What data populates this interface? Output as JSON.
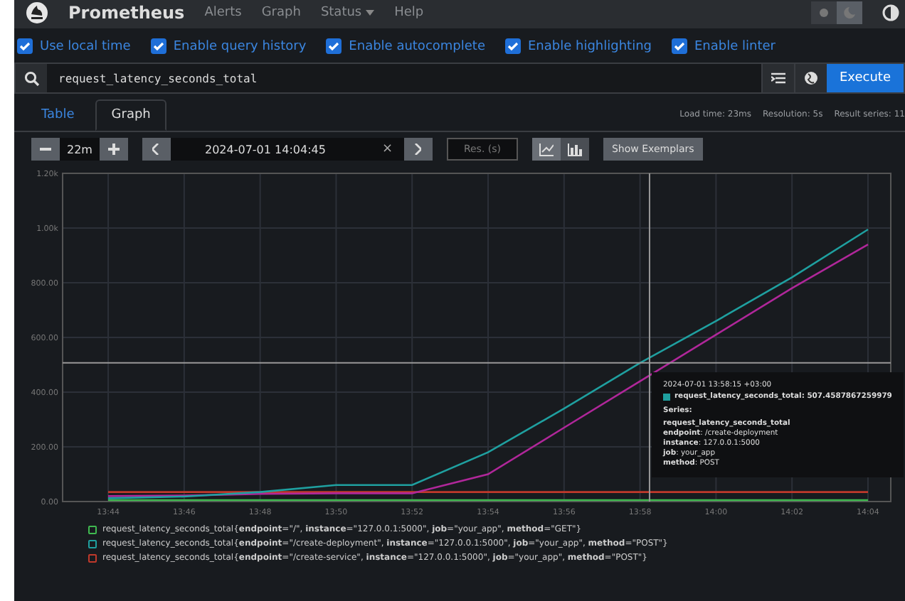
{
  "navbar": {
    "brand": "Prometheus",
    "links": [
      {
        "label": "Alerts",
        "dropdown": false
      },
      {
        "label": "Graph",
        "dropdown": false
      },
      {
        "label": "Status",
        "dropdown": true
      },
      {
        "label": "Help",
        "dropdown": false
      }
    ],
    "dark_mode": true
  },
  "options": [
    {
      "label": "Use local time",
      "checked": true
    },
    {
      "label": "Enable query history",
      "checked": true
    },
    {
      "label": "Enable autocomplete",
      "checked": true
    },
    {
      "label": "Enable highlighting",
      "checked": true
    },
    {
      "label": "Enable linter",
      "checked": true
    }
  ],
  "query": {
    "value": "request_latency_seconds_total",
    "execute": "Execute"
  },
  "tabs": [
    {
      "label": "Table",
      "selected": false
    },
    {
      "label": "Graph",
      "selected": true
    }
  ],
  "stats": [
    "Load time: 23ms",
    "Resolution: 5s",
    "Result series: 11"
  ],
  "controls": {
    "range": "22m",
    "end_time": "2024-07-01 14:04:45",
    "clear": "×",
    "resolution_placeholder": "Res. (s)",
    "exemplars": "Show Exemplars",
    "stacked": false
  },
  "chart_data": {
    "type": "line",
    "grid": true,
    "categories": [
      "13:44",
      "13:46",
      "13:48",
      "13:50",
      "13:52",
      "13:54",
      "13:56",
      "13:58",
      "14:00",
      "14:02",
      "14:04"
    ],
    "series": [
      {
        "color": "#3fb950",
        "values": [
          5,
          5,
          5,
          5,
          5,
          5,
          5,
          5,
          5,
          5,
          5
        ]
      },
      {
        "color": "#c0392b",
        "values": [
          35,
          35,
          35,
          35,
          35,
          35,
          35,
          35,
          35,
          35,
          35
        ]
      },
      {
        "color": "#b0279a",
        "values": [
          20,
          22,
          28,
          30,
          30,
          100,
          270,
          440,
          610,
          780,
          940
        ]
      },
      {
        "color": "#1fa0a0",
        "values": [
          12,
          18,
          35,
          60,
          60,
          180,
          340,
          507,
          660,
          820,
          995
        ]
      }
    ],
    "ylim": [
      0,
      1200
    ],
    "yticks": [
      {
        "value": 0,
        "label": "0.00"
      },
      {
        "value": 200,
        "label": "200.00"
      },
      {
        "value": 400,
        "label": "400.00"
      },
      {
        "value": 600,
        "label": "600.00"
      },
      {
        "value": 800,
        "label": "800.00"
      },
      {
        "value": 1000,
        "label": "1.00k"
      },
      {
        "value": 1200,
        "label": "1.20k"
      }
    ]
  },
  "tooltip": {
    "time": "2024-07-01 13:58:15 +03:00",
    "color": "#1fa0a0",
    "value": "request_latency_seconds_total: 507.4587867259979",
    "heading": "Series:",
    "lines": [
      "**request_latency_seconds_total**",
      "**endpoint**: /create-deployment",
      "**instance**: 127.0.0.1:5000",
      "**job**: your_app",
      "**method**: POST"
    ]
  },
  "legend": [
    {
      "color": "#3fb950",
      "text": "request_latency_seconds_total{**endpoint**=\"/\", **instance**=\"127.0.0.1:5000\", **job**=\"your_app\", **method**=\"GET\"}"
    },
    {
      "color": "#1fa0a0",
      "text": "request_latency_seconds_total{**endpoint**=\"/create-deployment\", **instance**=\"127.0.0.1:5000\", **job**=\"your_app\", **method**=\"POST\"}"
    },
    {
      "color": "#c0392b",
      "text": "request_latency_seconds_total{**endpoint**=\"/create-service\", **instance**=\"127.0.0.1:5000\", **job**=\"your_app\", **method**=\"POST\"}"
    }
  ]
}
